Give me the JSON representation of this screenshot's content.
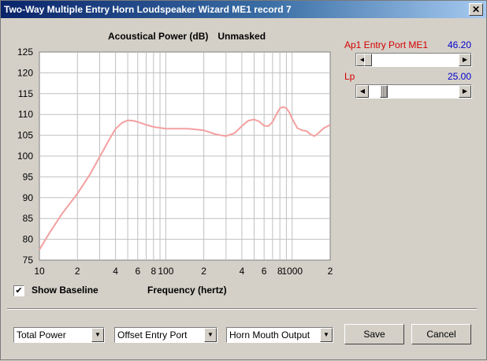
{
  "window": {
    "title": "Two-Way Multiple Entry Horn Loudspeaker Wizard   ME1 record 7",
    "close_glyph": "✕"
  },
  "chart": {
    "title": "Acoustical Power (dB)",
    "mode": "Unmasked",
    "xlabel": "Frequency (hertz)"
  },
  "chart_data": {
    "type": "line",
    "title": "Acoustical Power (dB)",
    "xlabel": "Frequency (hertz)",
    "ylabel": "",
    "x_scale": "log",
    "xlim": [
      10,
      2000
    ],
    "ylim": [
      75,
      125
    ],
    "grid": true,
    "yticks": [
      75,
      80,
      85,
      90,
      95,
      100,
      105,
      110,
      115,
      120,
      125
    ],
    "xticks": [
      {
        "value": 10,
        "label": "10"
      },
      {
        "value": 20,
        "label": "2"
      },
      {
        "value": 40,
        "label": "4"
      },
      {
        "value": 60,
        "label": "6"
      },
      {
        "value": 80,
        "label": "8"
      },
      {
        "value": 100,
        "label": "100"
      },
      {
        "value": 200,
        "label": "2"
      },
      {
        "value": 400,
        "label": "4"
      },
      {
        "value": 600,
        "label": "6"
      },
      {
        "value": 800,
        "label": "8"
      },
      {
        "value": 1000,
        "label": "1000"
      },
      {
        "value": 2000,
        "label": "2"
      }
    ],
    "line_color": "#f4a0a0",
    "series": [
      {
        "x": [
          10,
          12,
          15,
          20,
          25,
          30,
          35,
          40,
          45,
          50,
          55,
          60,
          70,
          80,
          100,
          120,
          150,
          200,
          250,
          300,
          350,
          400,
          450,
          500,
          550,
          600,
          650,
          700,
          750,
          800,
          850,
          900,
          950,
          1000,
          1100,
          1200,
          1300,
          1400,
          1500,
          1600,
          1700,
          1800,
          2000
        ],
        "y": [
          77.5,
          81.5,
          86,
          91,
          95.5,
          99.8,
          103.5,
          106.5,
          108,
          108.6,
          108.5,
          108.2,
          107.5,
          107,
          106.6,
          106.6,
          106.6,
          106.2,
          105.2,
          104.8,
          105.5,
          107.2,
          108.5,
          108.8,
          108.3,
          107.3,
          107.2,
          108.2,
          110,
          111.5,
          111.8,
          111.5,
          110.5,
          109,
          106.7,
          106.2,
          106,
          105.2,
          104.8,
          105.4,
          106.2,
          106.8,
          107.5
        ]
      }
    ]
  },
  "baseline": {
    "label": "Show Baseline",
    "checked": true,
    "check_glyph": "✔"
  },
  "sliders": [
    {
      "label": "Ap1  Entry Port  ME1",
      "value": "46.20",
      "position": 0.06
    },
    {
      "label": "Lp",
      "value": "25.00",
      "position": 0.24
    }
  ],
  "combos": [
    {
      "value": "Total Power"
    },
    {
      "value": "Offset Entry Port"
    },
    {
      "value": "Horn Mouth Output"
    }
  ],
  "buttons": {
    "save": "Save",
    "cancel": "Cancel"
  }
}
